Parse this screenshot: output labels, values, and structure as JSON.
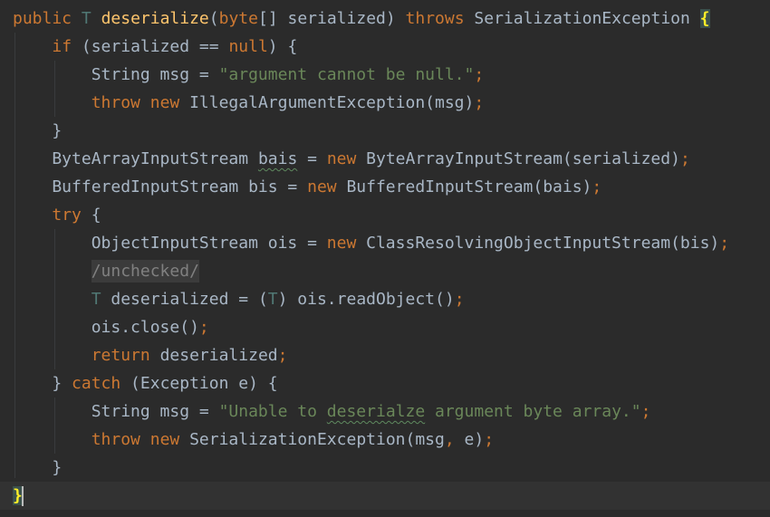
{
  "editor": {
    "lines": [
      {
        "tokens": [
          {
            "t": "public",
            "c": "kw",
            "n": "public-keyword"
          },
          {
            "t": " ",
            "c": "plain"
          },
          {
            "t": "T",
            "c": "tp",
            "n": "type-param"
          },
          {
            "t": " ",
            "c": "plain"
          },
          {
            "t": "deserialize",
            "c": "fn",
            "n": "method-name"
          },
          {
            "t": "(",
            "c": "plain"
          },
          {
            "t": "byte",
            "c": "kw",
            "n": "byte-keyword"
          },
          {
            "t": "[] serialized) ",
            "c": "plain"
          },
          {
            "t": "throws",
            "c": "kw",
            "n": "throws-keyword"
          },
          {
            "t": " SerializationException ",
            "c": "plain"
          },
          {
            "t": "{",
            "c": "brace-match",
            "n": "matched-brace"
          }
        ]
      },
      {
        "tokens": [
          {
            "t": "    ",
            "c": "plain"
          },
          {
            "t": "if",
            "c": "kw",
            "n": "if-keyword"
          },
          {
            "t": " (serialized == ",
            "c": "plain"
          },
          {
            "t": "null",
            "c": "kw",
            "n": "null-keyword"
          },
          {
            "t": ") {",
            "c": "plain"
          }
        ]
      },
      {
        "tokens": [
          {
            "t": "        String msg = ",
            "c": "plain"
          },
          {
            "t": "\"argument cannot be null.\"",
            "c": "str",
            "n": "string-literal"
          },
          {
            "t": ";",
            "c": "punct"
          }
        ]
      },
      {
        "tokens": [
          {
            "t": "        ",
            "c": "plain"
          },
          {
            "t": "throw",
            "c": "kw",
            "n": "throw-keyword"
          },
          {
            "t": " ",
            "c": "plain"
          },
          {
            "t": "new",
            "c": "kw",
            "n": "new-keyword"
          },
          {
            "t": " IllegalArgumentException(msg)",
            "c": "plain"
          },
          {
            "t": ";",
            "c": "punct"
          }
        ]
      },
      {
        "tokens": [
          {
            "t": "    }",
            "c": "plain"
          }
        ]
      },
      {
        "tokens": [
          {
            "t": "    ByteArrayInputStream ",
            "c": "plain"
          },
          {
            "t": "bais",
            "c": "plain squig",
            "n": "typo-warning"
          },
          {
            "t": " = ",
            "c": "plain"
          },
          {
            "t": "new",
            "c": "kw",
            "n": "new-keyword"
          },
          {
            "t": " ByteArrayInputStream(serialized)",
            "c": "plain"
          },
          {
            "t": ";",
            "c": "punct"
          }
        ]
      },
      {
        "tokens": [
          {
            "t": "    BufferedInputStream bis = ",
            "c": "plain"
          },
          {
            "t": "new",
            "c": "kw",
            "n": "new-keyword"
          },
          {
            "t": " BufferedInputStream(bais)",
            "c": "plain"
          },
          {
            "t": ";",
            "c": "punct"
          }
        ]
      },
      {
        "tokens": [
          {
            "t": "    ",
            "c": "plain"
          },
          {
            "t": "try",
            "c": "kw",
            "n": "try-keyword"
          },
          {
            "t": " {",
            "c": "plain"
          }
        ]
      },
      {
        "tokens": [
          {
            "t": "        ObjectInputStream ois = ",
            "c": "plain"
          },
          {
            "t": "new",
            "c": "kw",
            "n": "new-keyword"
          },
          {
            "t": " ClassResolvingObjectInputStream(bis)",
            "c": "plain"
          },
          {
            "t": ";",
            "c": "punct"
          }
        ]
      },
      {
        "tokens": [
          {
            "t": "        ",
            "c": "plain"
          },
          {
            "t": "/unchecked/",
            "c": "cmt",
            "n": "comment"
          }
        ]
      },
      {
        "tokens": [
          {
            "t": "        ",
            "c": "plain"
          },
          {
            "t": "T",
            "c": "tp",
            "n": "type-param"
          },
          {
            "t": " deserialized = (",
            "c": "plain"
          },
          {
            "t": "T",
            "c": "tp",
            "n": "type-param"
          },
          {
            "t": ") ois.readObject()",
            "c": "plain"
          },
          {
            "t": ";",
            "c": "punct"
          }
        ]
      },
      {
        "tokens": [
          {
            "t": "        ois.close()",
            "c": "plain"
          },
          {
            "t": ";",
            "c": "punct"
          }
        ]
      },
      {
        "tokens": [
          {
            "t": "        ",
            "c": "plain"
          },
          {
            "t": "return",
            "c": "kw",
            "n": "return-keyword"
          },
          {
            "t": " deserialized",
            "c": "plain"
          },
          {
            "t": ";",
            "c": "punct"
          }
        ]
      },
      {
        "tokens": [
          {
            "t": "    } ",
            "c": "plain"
          },
          {
            "t": "catch",
            "c": "kw",
            "n": "catch-keyword"
          },
          {
            "t": " (Exception e) {",
            "c": "plain"
          }
        ]
      },
      {
        "tokens": [
          {
            "t": "        String msg = ",
            "c": "plain"
          },
          {
            "t": "\"Unable to ",
            "c": "str",
            "n": "string-literal"
          },
          {
            "t": "deserialze",
            "c": "str squig",
            "n": "typo-warning"
          },
          {
            "t": " argument byte array.\"",
            "c": "str",
            "n": "string-literal"
          },
          {
            "t": ";",
            "c": "punct"
          }
        ]
      },
      {
        "tokens": [
          {
            "t": "        ",
            "c": "plain"
          },
          {
            "t": "throw",
            "c": "kw",
            "n": "throw-keyword"
          },
          {
            "t": " ",
            "c": "plain"
          },
          {
            "t": "new",
            "c": "kw",
            "n": "new-keyword"
          },
          {
            "t": " SerializationException(msg",
            "c": "plain"
          },
          {
            "t": ",",
            "c": "punct"
          },
          {
            "t": " e)",
            "c": "plain"
          },
          {
            "t": ";",
            "c": "punct"
          }
        ]
      },
      {
        "tokens": [
          {
            "t": "    }",
            "c": "plain"
          }
        ]
      },
      {
        "tokens": [
          {
            "t": "}",
            "c": "brace-match",
            "n": "matched-brace"
          }
        ],
        "current": true,
        "caret": true
      }
    ]
  }
}
